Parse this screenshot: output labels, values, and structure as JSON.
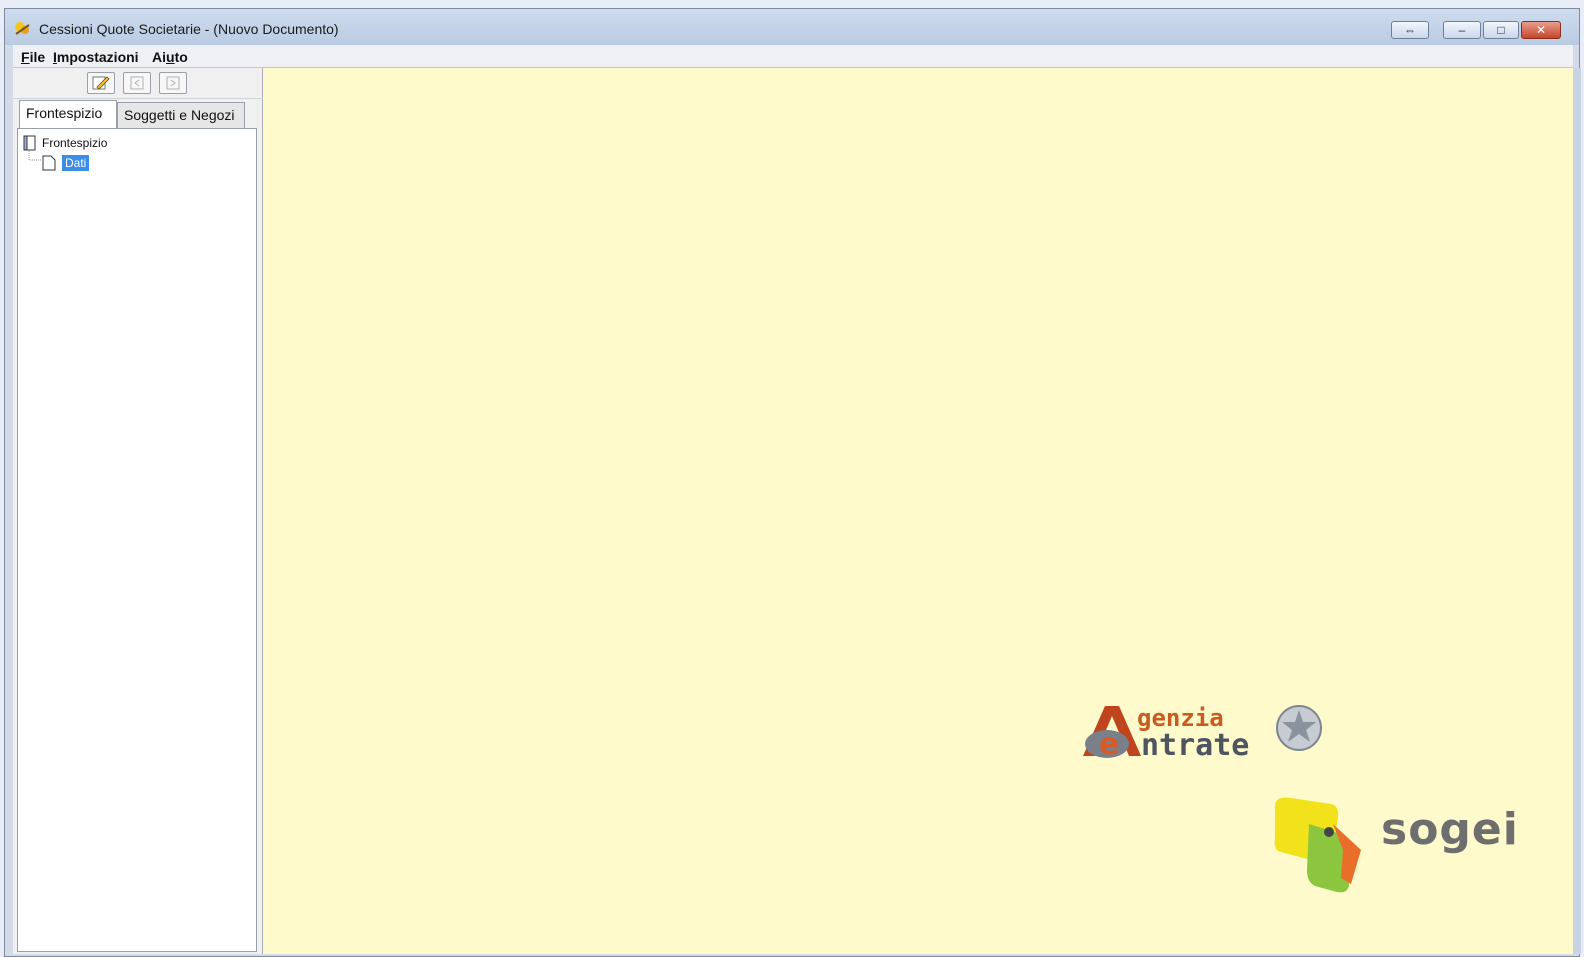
{
  "window": {
    "title": "Cessioni Quote Societarie - (Nuovo Documento)"
  },
  "titlebar_buttons": {
    "restore_symbol": "⇔",
    "minimize_symbol": "–",
    "maximize_symbol": "□",
    "close_symbol": "✕"
  },
  "menu": {
    "items": [
      {
        "label": "File",
        "underline": "F",
        "rest": "ile"
      },
      {
        "label": "Impostazioni",
        "underline": "I",
        "rest": "mpostazioni"
      },
      {
        "label": "Aiuto",
        "prefix": "Ai",
        "underline": "u",
        "rest": "to"
      }
    ]
  },
  "sidebar": {
    "tabs": [
      {
        "label": "Frontespizio",
        "active": true
      },
      {
        "label": "Soggetti e Negozi",
        "active": false
      }
    ],
    "tree": {
      "root_label": "Frontespizio",
      "children": [
        {
          "label": "Dati",
          "selected": true
        }
      ]
    }
  },
  "logos": {
    "agenzia_top": "genzia",
    "agenzia_bottom": "ntrate",
    "sogei": "sogei"
  },
  "colors": {
    "content_bg": "#fefacb",
    "selection": "#3a8ee6"
  }
}
